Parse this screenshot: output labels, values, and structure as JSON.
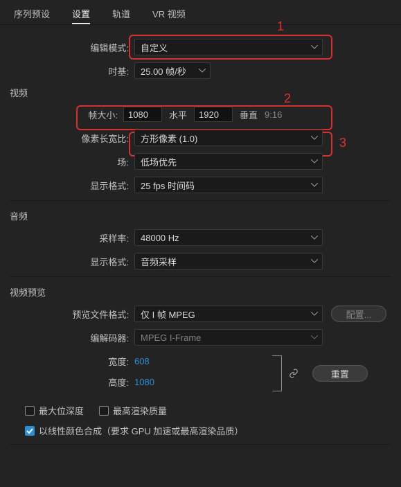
{
  "tabs": {
    "preset": "序列预设",
    "settings": "设置",
    "tracks": "轨道",
    "vr": "VR 视频"
  },
  "annot": {
    "a1": "1",
    "a2": "2",
    "a3": "3"
  },
  "edit": {
    "mode_label": "编辑模式:",
    "mode_value": "自定义",
    "timebase_label": "时基:",
    "timebase_value": "25.00 帧/秒"
  },
  "video": {
    "title": "视频",
    "framesize_label": "帧大小:",
    "width": "1080",
    "horiz": "水平",
    "height": "1920",
    "vert": "垂直",
    "ratio": "9:16",
    "pixel_ratio_label": "像素长宽比:",
    "pixel_ratio_value": "方形像素 (1.0)",
    "field_label": "场:",
    "field_value": "低场优先",
    "dispfmt_label": "显示格式:",
    "dispfmt_value": "25 fps 时间码"
  },
  "audio": {
    "title": "音频",
    "srate_label": "采样率:",
    "srate_value": "48000 Hz",
    "dispfmt_label": "显示格式:",
    "dispfmt_value": "音频采样"
  },
  "preview": {
    "title": "视频预览",
    "fmt_label": "预览文件格式:",
    "fmt_value": "仅 I 帧 MPEG",
    "codec_label": "编解码器:",
    "codec_value": "MPEG I-Frame",
    "width_label": "宽度:",
    "width_value": "608",
    "height_label": "高度:",
    "height_value": "1080",
    "config_btn": "配置...",
    "reset_btn": "重置"
  },
  "checks": {
    "maxbit": "最大位深度",
    "maxrender": "最高渲染质量",
    "linear": "以线性颜色合成（要求 GPU 加速或最高渲染品质）"
  }
}
